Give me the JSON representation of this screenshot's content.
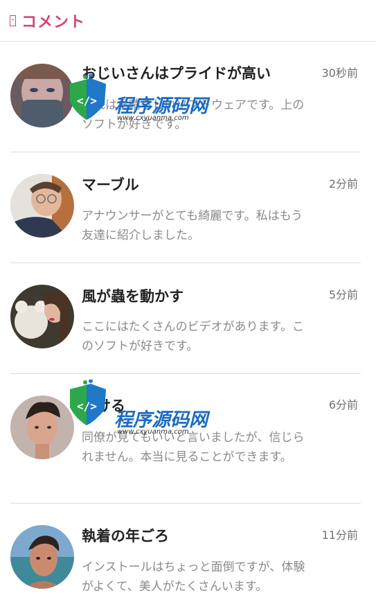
{
  "header": {
    "title": "コメント",
    "accent_color": "#d4407a",
    "icon": "note-icon"
  },
  "comments": [
    {
      "name": "おじいさんはプライドが高い",
      "time": "30秒前",
      "text": "これは素晴らしいソフトウェアです。上のソフトが好きです。"
    },
    {
      "name": "マーブル",
      "time": "2分前",
      "text": "アナウンサーがとても綺麗です。私はもう友達に紹介しました。"
    },
    {
      "name": "風が蟲を動かす",
      "time": "5分前",
      "text": "ここにはたくさんのビデオがあります。このソフトが好きです。"
    },
    {
      "name": "溶ける",
      "time": "6分前",
      "text": "同僚が見てもいいと言いましたが、信じられません。本当に見ることができます。"
    },
    {
      "name": "執着の年ごろ",
      "time": "11分前",
      "text": "インストールはちょっと面倒ですが、体験がよくて、美人がたくさんいます。"
    }
  ],
  "watermark": {
    "title": "程序源码网",
    "url": "www.cxyuanma.com"
  }
}
